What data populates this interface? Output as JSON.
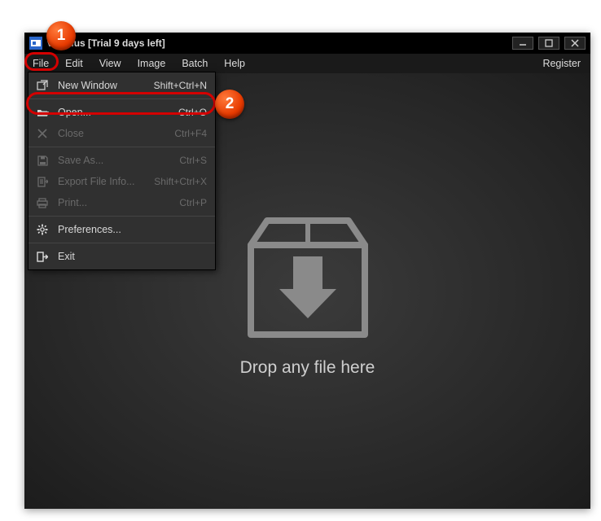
{
  "title": "ver Plus [Trial 9 days left]",
  "menubar": {
    "file": "File",
    "edit": "Edit",
    "view": "View",
    "image": "Image",
    "batch": "Batch",
    "help": "Help",
    "register": "Register"
  },
  "dropdown": {
    "new_window": {
      "label": "New Window",
      "shortcut": "Shift+Ctrl+N"
    },
    "open": {
      "label": "Open...",
      "shortcut": "Ctrl+O"
    },
    "close": {
      "label": "Close",
      "shortcut": "Ctrl+F4"
    },
    "save_as": {
      "label": "Save As...",
      "shortcut": "Ctrl+S"
    },
    "export": {
      "label": "Export File Info...",
      "shortcut": "Shift+Ctrl+X"
    },
    "print": {
      "label": "Print...",
      "shortcut": "Ctrl+P"
    },
    "prefs": {
      "label": "Preferences..."
    },
    "exit": {
      "label": "Exit"
    }
  },
  "content": {
    "drop_text": "Drop any file here"
  },
  "annotations": {
    "one": "1",
    "two": "2"
  }
}
